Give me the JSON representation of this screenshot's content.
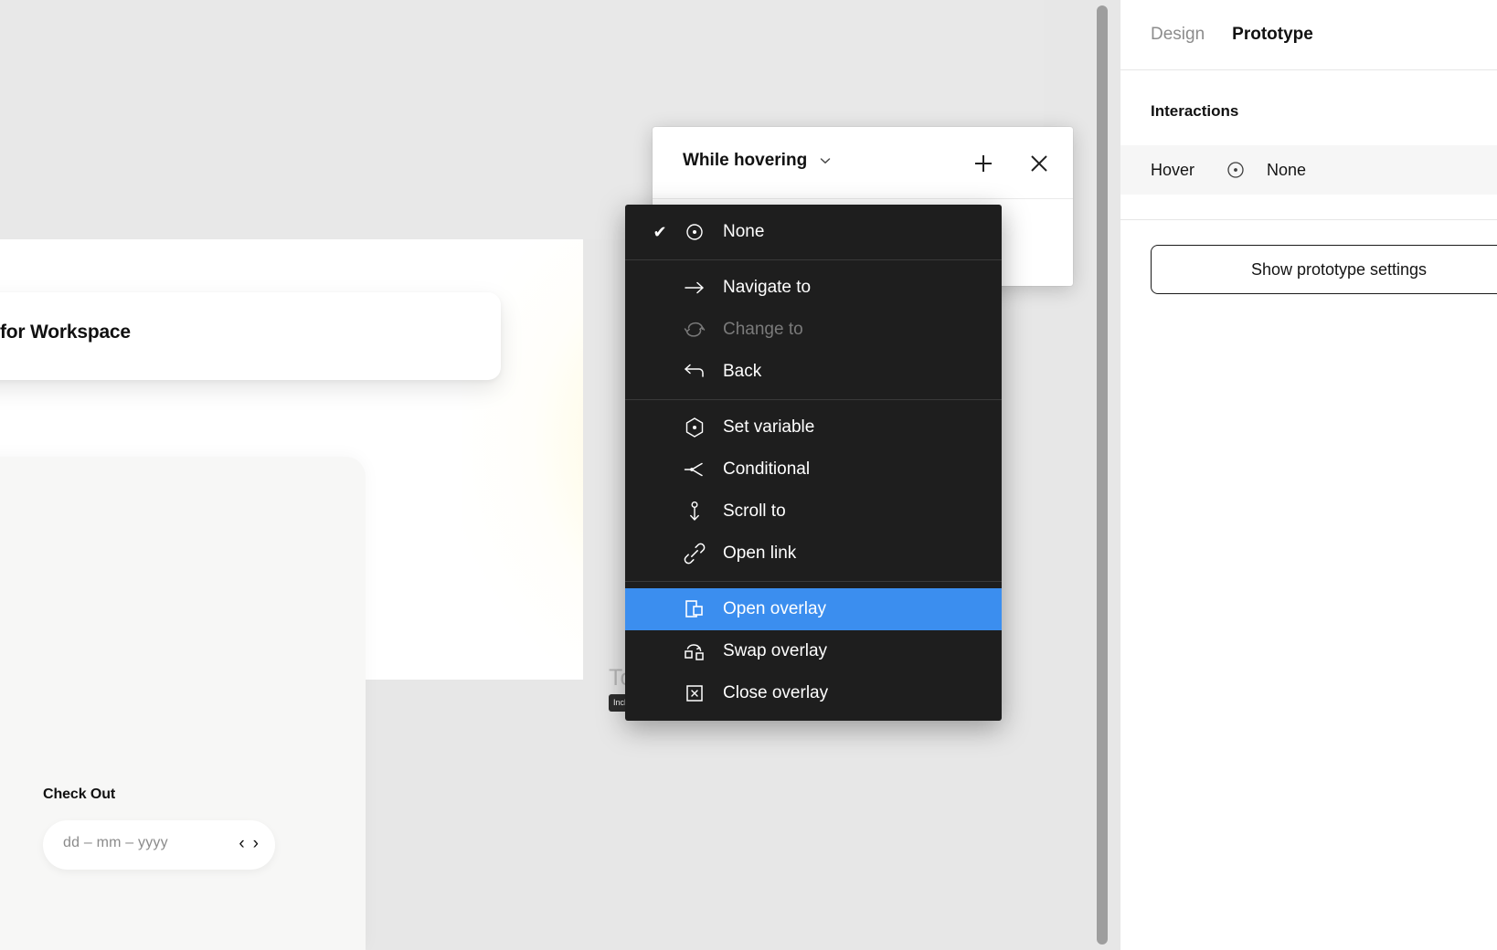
{
  "canvas": {
    "hero_text": "for Workspace",
    "field_label": "Check Out",
    "date_placeholder": "dd – mm – yyyy",
    "prev_arrow": "‹",
    "next_arrow": "›",
    "partial_text": "To",
    "partial_badge": "Inclu"
  },
  "interaction_popup": {
    "trigger_label": "While hovering",
    "chevron": "⌄",
    "add_title": "Add interaction",
    "close_title": "Close"
  },
  "action_menu": {
    "groups": [
      {
        "items": [
          {
            "label": "None",
            "icon": "none-icon",
            "checked": true,
            "disabled": false,
            "selected": false
          }
        ]
      },
      {
        "items": [
          {
            "label": "Navigate to",
            "icon": "arrow-right-icon",
            "checked": false,
            "disabled": false,
            "selected": false
          },
          {
            "label": "Change to",
            "icon": "change-to-icon",
            "checked": false,
            "disabled": true,
            "selected": false
          },
          {
            "label": "Back",
            "icon": "arrow-back-icon",
            "checked": false,
            "disabled": false,
            "selected": false
          }
        ]
      },
      {
        "items": [
          {
            "label": "Set variable",
            "icon": "variable-hex-icon",
            "checked": false,
            "disabled": false,
            "selected": false
          },
          {
            "label": "Conditional",
            "icon": "conditional-icon",
            "checked": false,
            "disabled": false,
            "selected": false
          },
          {
            "label": "Scroll to",
            "icon": "scroll-to-icon",
            "checked": false,
            "disabled": false,
            "selected": false
          },
          {
            "label": "Open link",
            "icon": "link-icon",
            "checked": false,
            "disabled": false,
            "selected": false
          }
        ]
      },
      {
        "items": [
          {
            "label": "Open overlay",
            "icon": "open-overlay-icon",
            "checked": false,
            "disabled": false,
            "selected": true
          },
          {
            "label": "Swap overlay",
            "icon": "swap-overlay-icon",
            "checked": false,
            "disabled": false,
            "selected": false
          },
          {
            "label": "Close overlay",
            "icon": "close-overlay-icon",
            "checked": false,
            "disabled": false,
            "selected": false
          }
        ]
      }
    ],
    "check_glyph": "✔",
    "highlight_color": "#3b8eef",
    "background_color": "#1e1e1e"
  },
  "right_panel": {
    "tabs": [
      {
        "label": "Design",
        "active": false
      },
      {
        "label": "Prototype",
        "active": true
      }
    ],
    "section_title": "Interactions",
    "interaction": {
      "trigger": "Hover",
      "action": "None"
    },
    "show_prototype_settings": "Show prototype settings"
  }
}
